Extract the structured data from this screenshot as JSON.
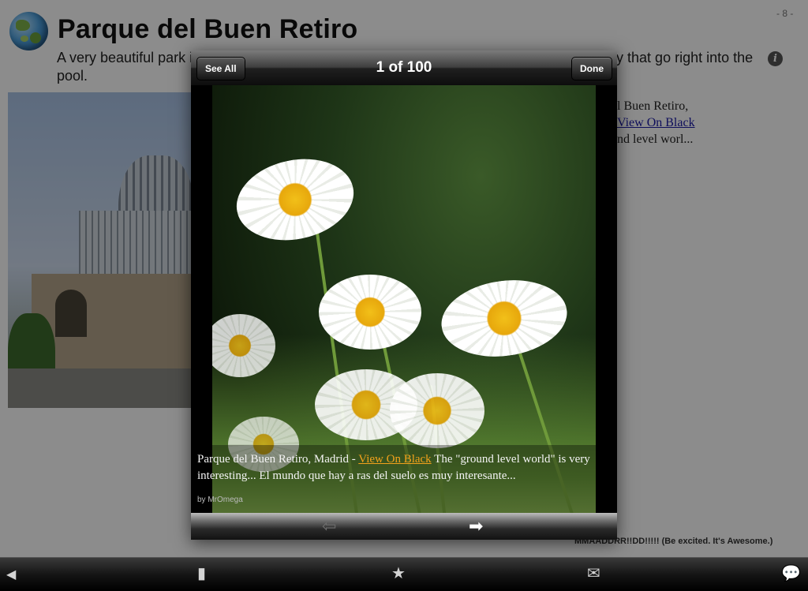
{
  "page": {
    "page_number": "- 8 -",
    "title": "Parque del Buen Retiro",
    "description": "A very beautiful park in Madrid with many sights and things to see. There are stairs nearby that go right into the pool.",
    "side_text": {
      "line1": "l Buen Retiro,",
      "link": "View On Black",
      "line3": "nd level worl..."
    },
    "footnote": "MMAADDRR!!DD!!!!! (Be excited.  It's Awesome.)"
  },
  "gallery": {
    "see_all_label": "See All",
    "done_label": "Done",
    "counter": "1 of 100",
    "caption": {
      "prefix": "Parque del Buen Retiro, Madrid - ",
      "link": "View On Black",
      "suffix": " The \"ground level world\" is very interesting... El mundo que hay a ras del suelo es muy interesante...",
      "byline": "by  MrOmega"
    },
    "prev_icon": "left-arrow-icon",
    "next_icon": "right-arrow-icon"
  },
  "toolbar": {
    "icons": [
      "back-icon",
      "book-icon",
      "star-icon",
      "mail-icon",
      "chat-icon"
    ],
    "glyphs": {
      "back": "◀",
      "book": "▮",
      "star": "★",
      "mail": "✉",
      "chat": "💬"
    }
  },
  "colors": {
    "link_orange": "#f3a21b",
    "link_blue": "#1a1aa6"
  }
}
